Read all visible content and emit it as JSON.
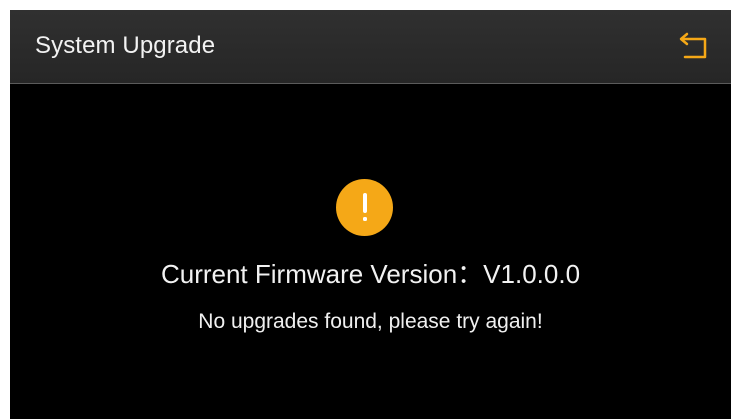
{
  "header": {
    "title": "System Upgrade"
  },
  "main": {
    "status_icon": "warning-icon",
    "version_label": "Current Firmware Version",
    "version_separator": "：",
    "version_value": "V1.0.0.0",
    "message": "No upgrades found, please try again!"
  },
  "icons": {
    "back": "back-arrow-icon",
    "warning": "exclamation-icon"
  },
  "colors": {
    "accent": "#F5A817",
    "background": "#000000",
    "header_background": "#2B2B2B",
    "text": "#F2F2F2"
  }
}
